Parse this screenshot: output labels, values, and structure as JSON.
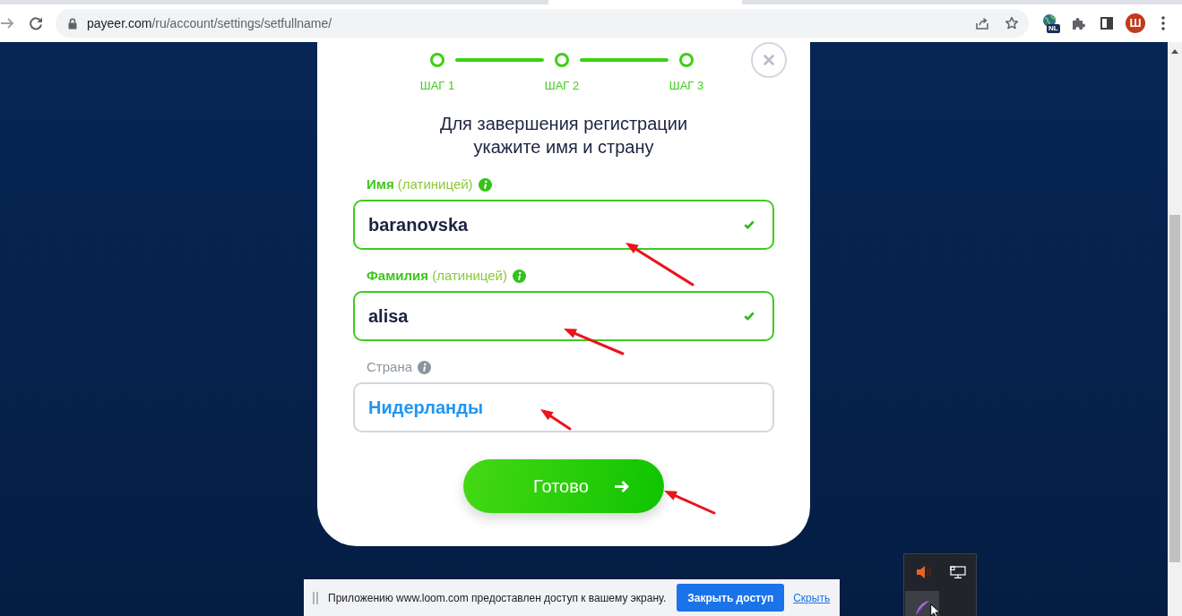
{
  "browser": {
    "url_host": "payeer.com",
    "url_path": "/ru/account/settings/setfullname/",
    "extension_badge": "NL",
    "profile_initial": "Ш"
  },
  "dialog": {
    "steps": [
      {
        "label": "ШАГ 1",
        "done": true
      },
      {
        "label": "ШАГ 2",
        "done": true
      },
      {
        "label": "ШАГ 3",
        "done": true
      }
    ],
    "title_lines": [
      "Для завершения регистрации",
      "укажите имя и страну"
    ],
    "fields": [
      {
        "label": "**Имя** (латиницей)",
        "value": "baranovska",
        "valid": true,
        "kind": "text"
      },
      {
        "label": "**Фамилия** (латиницей)",
        "value": "alisa",
        "valid": true,
        "kind": "text"
      },
      {
        "label": "Страна",
        "value": "Нидерланды",
        "valid": false,
        "kind": "select"
      }
    ],
    "submit": "Готово"
  },
  "share_bar": {
    "message": "Приложению www.loom.com предоставлен доступ к вашему экрану.",
    "stop_button": "Закрыть доступ",
    "hide_link": "Скрыть"
  }
}
